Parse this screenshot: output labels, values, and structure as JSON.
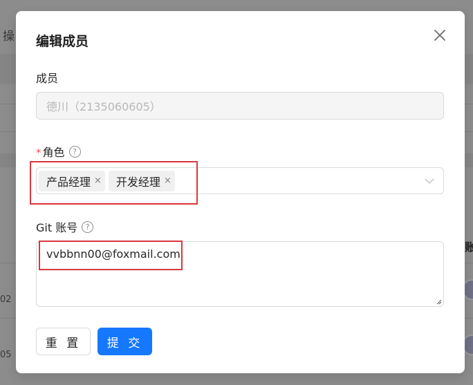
{
  "background": {
    "partial_texts": [
      "操",
      "02",
      "05",
      "账"
    ]
  },
  "modal": {
    "title": "编辑成员",
    "close_icon": "close-icon"
  },
  "form": {
    "member": {
      "label": "成员",
      "value": "德川（2135060605）"
    },
    "role": {
      "label": "角色",
      "required": true,
      "tags": [
        "产品经理",
        "开发经理"
      ],
      "tag_close_glyph": "×"
    },
    "git": {
      "label": "Git 账号",
      "value": "vvbbnn00@foxmail.com"
    }
  },
  "buttons": {
    "reset": "重 置",
    "submit": "提 交"
  },
  "colors": {
    "primary": "#1677ff",
    "highlight": "#d9363e",
    "required": "#ff4d4f"
  }
}
